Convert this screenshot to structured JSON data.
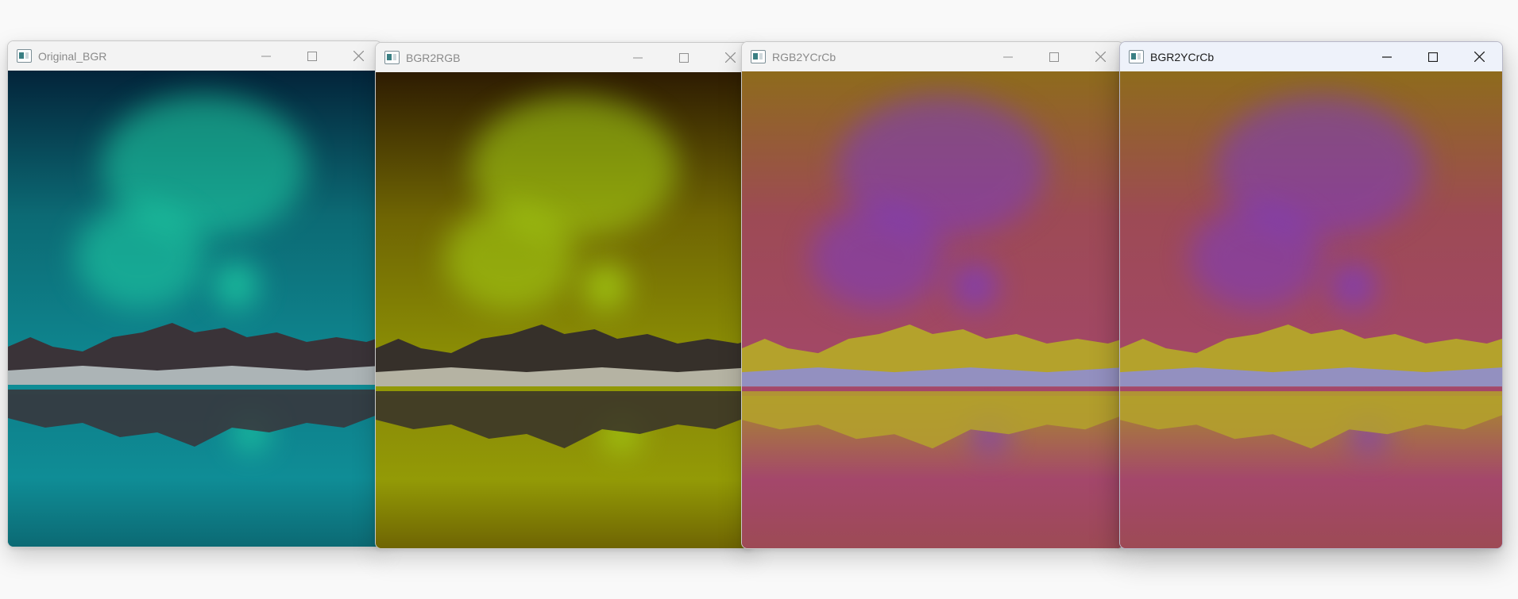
{
  "windows": [
    {
      "title": "Original_BGR",
      "active": false,
      "sky_top": "#03243a",
      "sky_mid": "#0c6a74",
      "sky_bottom": "#0f8d96",
      "aurora": "#1fd3a6",
      "mountain": "#3a3338",
      "snow": "#c9d4d6",
      "water": "#0e7f8a"
    },
    {
      "title": "BGR2RGB",
      "active": false,
      "sky_top": "#2e1c02",
      "sky_mid": "#6f6503",
      "sky_bottom": "#939a06",
      "aurora": "#a8d615",
      "mountain": "#36302a",
      "snow": "#d6d4c2",
      "water": "#8a8a08"
    },
    {
      "title": "RGB2YCrCb",
      "active": false,
      "sky_top": "#8e6b1c",
      "sky_mid": "#9d4a55",
      "sky_bottom": "#a4476b",
      "aurora": "#7b3bc4",
      "mountain": "#b4a22c",
      "snow": "#8b8ce6",
      "water": "#a88a2e"
    },
    {
      "title": "BGR2YCrCb",
      "active": true,
      "sky_top": "#8e6b1c",
      "sky_mid": "#9d4a55",
      "sky_bottom": "#a4476b",
      "aurora": "#7b3bc4",
      "mountain": "#b4a22c",
      "snow": "#8b8ce6",
      "water": "#a88a2e"
    }
  ],
  "icons": {
    "app": "opencv-window-icon",
    "minimize": "minimize-icon",
    "maximize": "maximize-icon",
    "close": "close-icon"
  }
}
